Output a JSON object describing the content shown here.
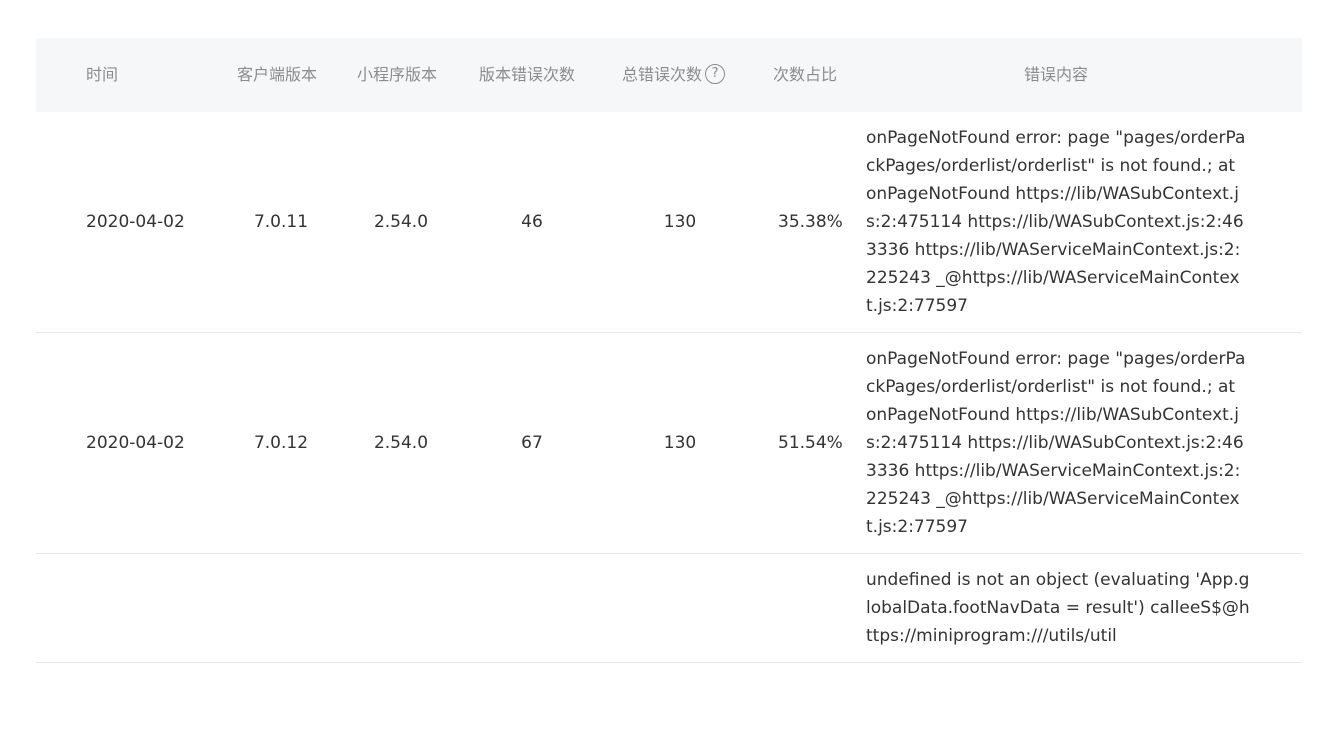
{
  "table": {
    "headers": {
      "time": "时间",
      "client_version": "客户端版本",
      "mp_version": "小程序版本",
      "version_errors": "版本错误次数",
      "total_errors": "总错误次数",
      "ratio": "次数占比",
      "content": "错误内容",
      "help_icon": "?"
    },
    "rows": [
      {
        "time": "2020-04-02",
        "client_version": "7.0.11",
        "mp_version": "2.54.0",
        "version_errors": "46",
        "total_errors": "130",
        "ratio": "35.38%",
        "content": "onPageNotFound error: page \"pages/orderPackPages/orderlist/orderlist\" is not found.; at onPageNotFound https://lib/WASubContext.js:2:475114 https://lib/WASubContext.js:2:463336 https://lib/WAServiceMainContext.js:2:225243 _@https://lib/WAServiceMainContext.js:2:77597"
      },
      {
        "time": "2020-04-02",
        "client_version": "7.0.12",
        "mp_version": "2.54.0",
        "version_errors": "67",
        "total_errors": "130",
        "ratio": "51.54%",
        "content": "onPageNotFound error: page \"pages/orderPackPages/orderlist/orderlist\" is not found.; at onPageNotFound https://lib/WASubContext.js:2:475114 https://lib/WASubContext.js:2:463336 https://lib/WAServiceMainContext.js:2:225243 _@https://lib/WAServiceMainContext.js:2:77597"
      },
      {
        "time": "",
        "client_version": "",
        "mp_version": "",
        "version_errors": "",
        "total_errors": "",
        "ratio": "",
        "content": "undefined is not an object (evaluating 'App.globalData.footNavData = result') calleeS$@https://miniprogram:///utils/util"
      }
    ]
  }
}
